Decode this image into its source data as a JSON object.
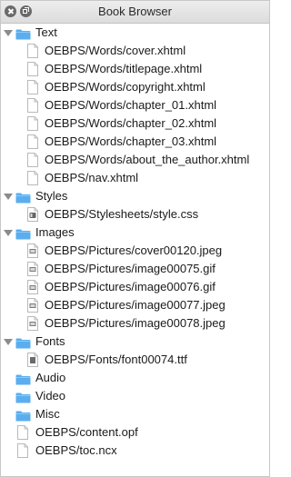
{
  "window": {
    "title": "Book Browser"
  },
  "colors": {
    "folder": "#5aaef0",
    "file_outline": "#b9b9b9",
    "disclosure": "#8b8b8b"
  },
  "tree": {
    "text": {
      "label": "Text",
      "files": [
        "OEBPS/Words/cover.xhtml",
        "OEBPS/Words/titlepage.xhtml",
        "OEBPS/Words/copyright.xhtml",
        "OEBPS/Words/chapter_01.xhtml",
        "OEBPS/Words/chapter_02.xhtml",
        "OEBPS/Words/chapter_03.xhtml",
        "OEBPS/Words/about_the_author.xhtml",
        "OEBPS/nav.xhtml"
      ]
    },
    "styles": {
      "label": "Styles",
      "files": [
        "OEBPS/Stylesheets/style.css"
      ]
    },
    "images": {
      "label": "Images",
      "files": [
        "OEBPS/Pictures/cover00120.jpeg",
        "OEBPS/Pictures/image00075.gif",
        "OEBPS/Pictures/image00076.gif",
        "OEBPS/Pictures/image00077.jpeg",
        "OEBPS/Pictures/image00078.jpeg"
      ]
    },
    "fonts": {
      "label": "Fonts",
      "files": [
        "OEBPS/Fonts/font00074.ttf"
      ]
    },
    "audio": {
      "label": "Audio"
    },
    "video": {
      "label": "Video"
    },
    "misc": {
      "label": "Misc"
    },
    "root_files": [
      "OEBPS/content.opf",
      "OEBPS/toc.ncx"
    ]
  }
}
